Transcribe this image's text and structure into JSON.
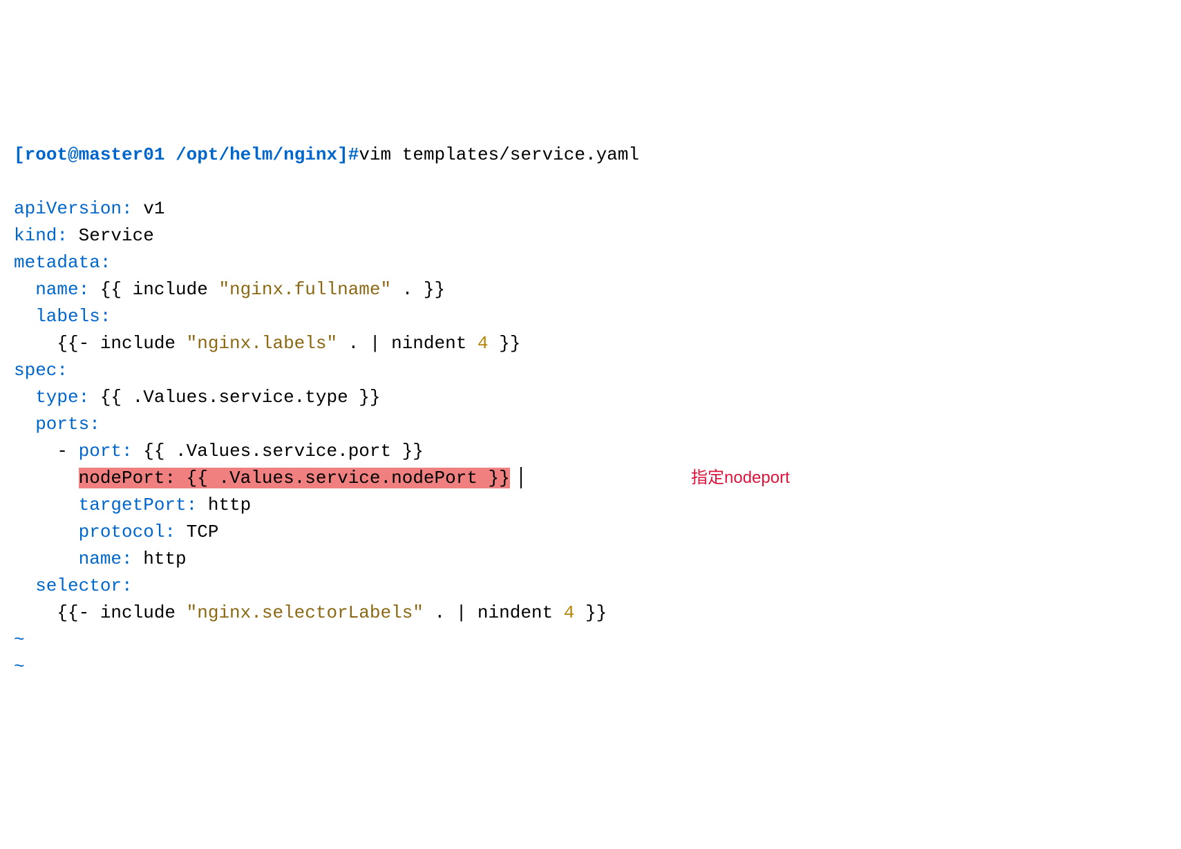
{
  "prompt": {
    "open_bracket": "[",
    "user_host": "root@master01",
    "space": " ",
    "path": "/opt/helm/nginx",
    "close_bracket": "]#",
    "command": "vim templates/service.yaml"
  },
  "yaml": {
    "apiVersion_key": "apiVersion:",
    "apiVersion_val": " v1",
    "kind_key": "kind:",
    "kind_val": " Service",
    "metadata_key": "metadata:",
    "name_key": "  name:",
    "name_val_open": " {{ include ",
    "name_val_str": "\"nginx.fullname\"",
    "name_val_close": " . }}",
    "labels_key": "  labels:",
    "labels_val_open": "    {{- include ",
    "labels_val_str": "\"nginx.labels\"",
    "labels_val_close": " . | nindent ",
    "labels_val_num": "4",
    "labels_val_end": " }}",
    "spec_key": "spec:",
    "type_key": "  type:",
    "type_val": " {{ .Values.service.type }}",
    "ports_key": "  ports:",
    "port_dash": "    - ",
    "port_key": "port:",
    "port_val": " {{ .Values.service.port }}",
    "nodePort_indent": "      ",
    "nodePort_key": "nodePort:",
    "nodePort_val": " {{ .Values.service.nodePort }}",
    "nodePort_trail": " ",
    "targetPort_key": "      targetPort:",
    "targetPort_val": " http",
    "protocol_key": "      protocol:",
    "protocol_val": " TCP",
    "portname_key": "      name:",
    "portname_val": " http",
    "selector_key": "  selector:",
    "selector_val_open": "    {{- include ",
    "selector_val_str": "\"nginx.selectorLabels\"",
    "selector_val_close": " . | nindent ",
    "selector_val_num": "4",
    "selector_val_end": " }}"
  },
  "tilde1": "~",
  "tilde2": "~",
  "annotation": "指定nodeport"
}
